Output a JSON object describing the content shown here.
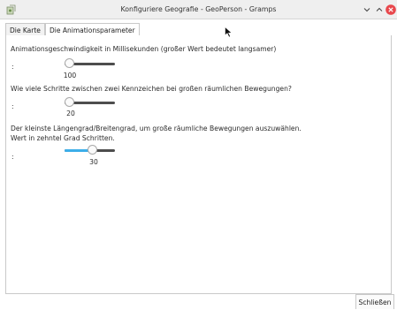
{
  "window": {
    "title": "Konfiguriere Geografie - GeoPerson - Gramps"
  },
  "tabs": [
    {
      "label": "Die Karte",
      "active": false
    },
    {
      "label": "Die Animationsparameter",
      "active": true
    }
  ],
  "params": [
    {
      "question": "Animationsgeschwindigkeit in Millisekunden (großer Wert bedeutet langsamer)",
      "value_label": "100",
      "level": 0.0
    },
    {
      "question": "Wie viele Schritte zwischen zwei Kennzeichen bei großen räumlichen Bewegungen?",
      "value_label": "20",
      "level": 0.0
    },
    {
      "question_line1": "Der kleinste Längengrad/Breitengrad, um große räumliche Bewegungen auszuwählen.",
      "question_line2": "Wert in zehntel Grad Schritten.",
      "value_label": "30",
      "level": 0.55
    }
  ],
  "colon": ":",
  "buttons": {
    "close_label": "Schließen"
  },
  "colors": {
    "slider_fill": "#3daee9",
    "slider_track": "#4d4d4d",
    "close_window": "#e8474c"
  }
}
